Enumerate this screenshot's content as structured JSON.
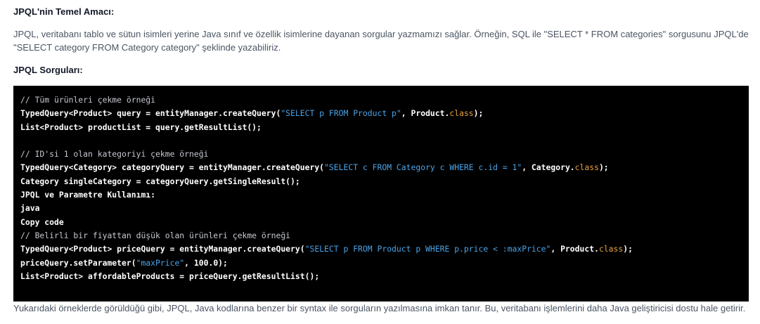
{
  "sections": {
    "purpose_heading": "JPQL'nin Temel Amacı:",
    "purpose_text": "JPQL, veritabanı tablo ve sütun isimleri yerine Java sınıf ve özellik isimlerine dayanan sorgular yazmamızı sağlar. Örneğin, SQL ile \"SELECT * FROM categories\" sorgusunu JPQL'de \"SELECT category FROM Category category\" şeklinde yazabiliriz.",
    "queries_heading": "JPQL Sorguları:",
    "closing_text": "Yukarıdaki örneklerde görüldüğü gibi, JPQL, Java kodlarına benzer bir syntax ile sorguların yazılmasına imkan tanır. Bu, veritabanı işlemlerini daha Java geliştiricisi dostu hale getirir."
  },
  "code": {
    "lines": [
      [
        {
          "t": "comment",
          "v": "// Tüm ürünleri çekme örneği"
        }
      ],
      [
        {
          "t": "plain",
          "v": "TypedQuery<Product> query = entityManager.createQuery("
        },
        {
          "t": "string",
          "v": "\"SELECT p FROM Product p\""
        },
        {
          "t": "plain",
          "v": ", Product."
        },
        {
          "t": "keyword",
          "v": "class"
        },
        {
          "t": "plain",
          "v": ");"
        }
      ],
      [
        {
          "t": "plain",
          "v": "List<Product> productList = query.getResultList();"
        }
      ],
      [],
      [
        {
          "t": "comment",
          "v": "// ID'si 1 olan kategoriyi çekme örneği"
        }
      ],
      [
        {
          "t": "plain",
          "v": "TypedQuery<Category> categoryQuery = entityManager.createQuery("
        },
        {
          "t": "string",
          "v": "\"SELECT c FROM Category c WHERE c.id = 1\""
        },
        {
          "t": "plain",
          "v": ", Category."
        },
        {
          "t": "keyword",
          "v": "class"
        },
        {
          "t": "plain",
          "v": ");"
        }
      ],
      [
        {
          "t": "plain",
          "v": "Category singleCategory = categoryQuery.getSingleResult();"
        }
      ],
      [
        {
          "t": "plain",
          "v": "JPQL ve Parametre Kullanımı:"
        }
      ],
      [
        {
          "t": "plain",
          "v": "java"
        }
      ],
      [
        {
          "t": "plain",
          "v": "Copy code"
        }
      ],
      [
        {
          "t": "comment",
          "v": "// Belirli bir fiyattan düşük olan ürünleri çekme örneği"
        }
      ],
      [
        {
          "t": "plain",
          "v": "TypedQuery<Product> priceQuery = entityManager.createQuery("
        },
        {
          "t": "string",
          "v": "\"SELECT p FROM Product p WHERE p.price < :maxPrice\""
        },
        {
          "t": "plain",
          "v": ", Product."
        },
        {
          "t": "keyword",
          "v": "class"
        },
        {
          "t": "plain",
          "v": ");"
        }
      ],
      [
        {
          "t": "plain",
          "v": "priceQuery.setParameter("
        },
        {
          "t": "string",
          "v": "\"maxPrice\""
        },
        {
          "t": "plain",
          "v": ", 100.0);"
        }
      ],
      [
        {
          "t": "plain",
          "v": "List<Product> affordableProducts = priceQuery.getResultList();"
        }
      ]
    ]
  },
  "colors": {
    "code_background": "#000000",
    "comment": "#c5c8d0",
    "string": "#4aa3e8",
    "keyword": "#e6a23c",
    "plain": "#ffffff"
  }
}
